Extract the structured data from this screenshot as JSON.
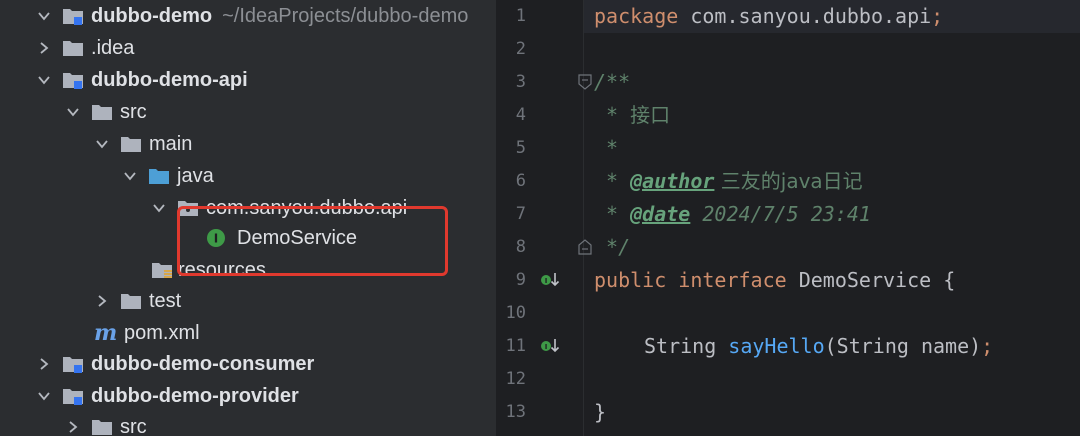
{
  "tree": {
    "root": {
      "label": "dubbo-demo",
      "path": "~/IdeaProjects/dubbo-demo"
    },
    "idea": "idea",
    "api_module": "dubbo-demo-api",
    "src": "src",
    "main": "main",
    "java": "java",
    "package": "com.sanyou.dubbo.api",
    "demo_service": "DemoService",
    "resources": "resources",
    "test": "test",
    "pom": "pom.xml",
    "consumer_module": "dubbo-demo-consumer",
    "provider_module": "dubbo-demo-provider",
    "provider_src": "src"
  },
  "editor": {
    "line_numbers": [
      "1",
      "2",
      "3",
      "4",
      "5",
      "6",
      "7",
      "8",
      "9",
      "10",
      "11",
      "12",
      "13"
    ],
    "code": {
      "l1_kw": "package",
      "l1_rest": " com.sanyou.dubbo.api",
      "l1_semi": ";",
      "l3": "/**",
      "l4_star": " * ",
      "l4_text": "接口",
      "l5": " *",
      "l6_star": " * ",
      "l6_tag": "@author",
      "l6_val": " 三友的java日记",
      "l7_star": " * ",
      "l7_tag": "@date",
      "l7_val": " 2024/7/5 23:41",
      "l8": " */",
      "l9_kw1": "public",
      "l9_kw2": "interface",
      "l9_name": "DemoService",
      "l9_brace": " {",
      "l11_type": "String ",
      "l11_fn": "sayHello",
      "l11_params": "(String name)",
      "l11_semi": ";",
      "l13": "}"
    }
  },
  "colors": {
    "keyword": "#cf8e6d",
    "doc_comment": "#5f826b",
    "method": "#56a8f5",
    "highlight_box": "#e0392e",
    "interface_icon": "#3e9a47",
    "folder": "#aeb3bd",
    "source_folder": "#4d9fd6"
  }
}
